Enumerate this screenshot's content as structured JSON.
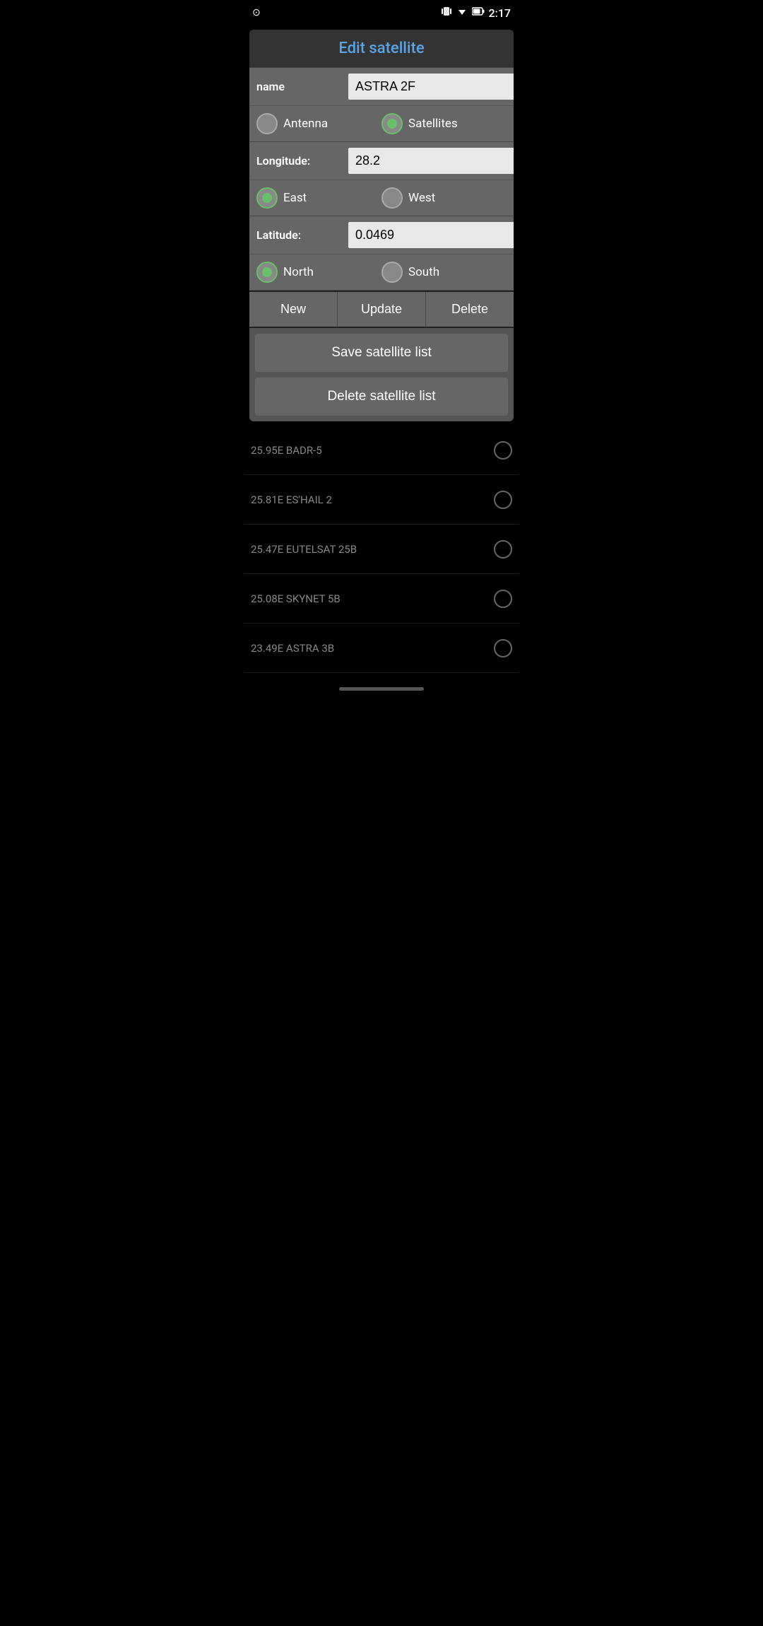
{
  "statusBar": {
    "time": "2:17",
    "icons": {
      "notification": "⊘",
      "vibrate": "▦",
      "wifi": "▲",
      "battery": "▮"
    }
  },
  "dialog": {
    "title": "Edit satellite",
    "nameLabel": "name",
    "nameValue": "ASTRA 2F",
    "antennaLabel": "Antenna",
    "satellitesLabel": "Satellites",
    "longitudeLabel": "Longitude:",
    "longitudeValue": "28.2",
    "eastLabel": "East",
    "westLabel": "West",
    "latitudeLabel": "Latitude:",
    "latitudeValue": "0.0469",
    "northLabel": "North",
    "southLabel": "South",
    "buttons": {
      "new": "New",
      "update": "Update",
      "delete": "Delete",
      "saveSatelliteList": "Save satellite list",
      "deleteSatelliteList": "Delete satellite list"
    }
  },
  "satelliteList": [
    {
      "id": "sat1",
      "name": "25.95E BADR-5"
    },
    {
      "id": "sat2",
      "name": "25.81E ES'HAIL 2"
    },
    {
      "id": "sat3",
      "name": "25.47E EUTELSAT 25B"
    },
    {
      "id": "sat4",
      "name": "25.08E SKYNET 5B"
    },
    {
      "id": "sat5",
      "name": "23.49E ASTRA 3B"
    }
  ],
  "radioState": {
    "antennaSelected": false,
    "satellitesSelected": true,
    "eastSelected": true,
    "westSelected": false,
    "northSelected": true,
    "southSelected": false
  }
}
